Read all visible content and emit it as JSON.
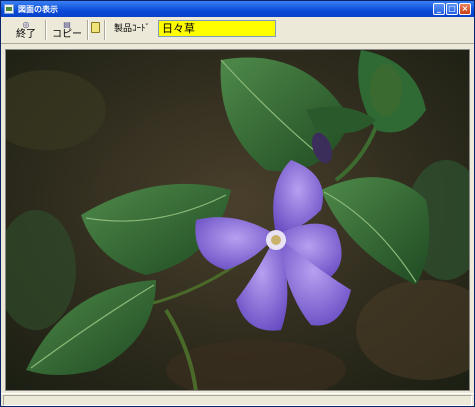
{
  "window": {
    "title": "図面の表示",
    "controls": [
      "minimize-icon",
      "maximize-icon",
      "close-icon"
    ]
  },
  "toolbar": {
    "exit_label": "終了",
    "copy_label": "コピー",
    "help_icon": "help-book-icon",
    "product_code_label": "製品ｺｰﾄﾞ",
    "product_code_value": "日々草"
  },
  "image": {
    "subject": "periwinkle-flower-photo"
  },
  "colors": {
    "field_bg": "#ffff00",
    "title_bar": "#0b4bd8"
  }
}
